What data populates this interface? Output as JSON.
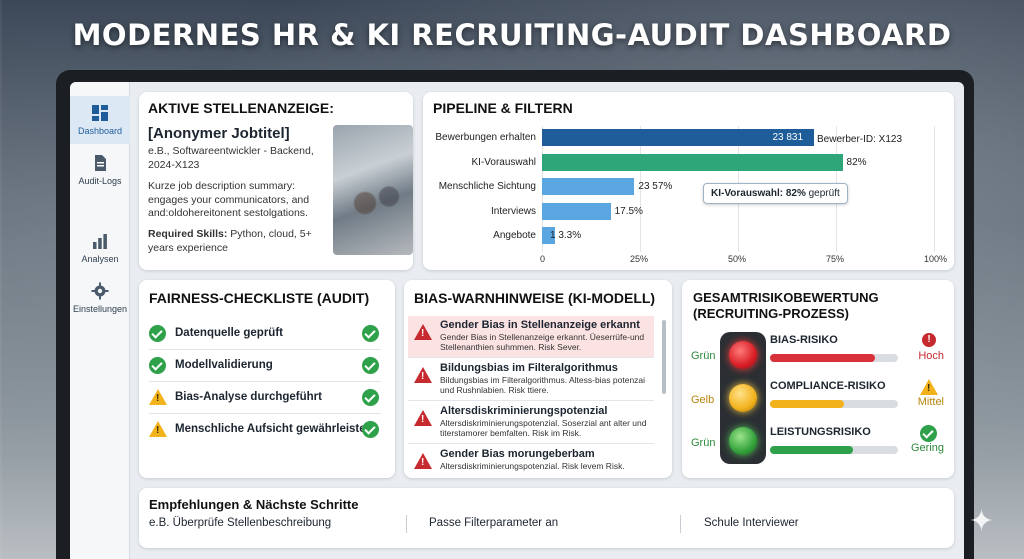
{
  "headline": "MODERNES HR & KI RECRUITING-AUDIT DASHBOARD",
  "sidebar": {
    "items": [
      {
        "label": "Dashboard",
        "icon": "dashboard-icon",
        "active": true
      },
      {
        "label": "Audit-Logs",
        "icon": "document-icon",
        "active": false
      },
      {
        "label": "Analysen",
        "icon": "bar-chart-icon",
        "active": false
      },
      {
        "label": "Einstellungen",
        "icon": "gear-icon",
        "active": false
      }
    ]
  },
  "job": {
    "heading": "AKTIVE STELLENANZEIGE:",
    "title": "[Anonymer Jobtitel]",
    "subtitle": "e.B., Softwareentwickler - Backend, 2024-X123",
    "summary": "Kurze job description summary: engages your communicators, and and:oldohereitonent sestolgations.",
    "skills_label": "Required Skills:",
    "skills_value": " Python, cloud, 5+ years experience"
  },
  "pipeline": {
    "heading": "PIPELINE & FILTERN",
    "tooltip_label": "KI-Vorauswahl: ",
    "tooltip_value": "82%",
    "tooltip_suffix": " geprüft",
    "id_label": "Bewerber-ID: X123"
  },
  "chart_data": {
    "type": "bar",
    "orientation": "horizontal",
    "categories": [
      "Bewerbungen erhalten",
      "KI-Vorauswahl",
      "Menschliche Sichtung",
      "Interviews",
      "Angebote"
    ],
    "values": [
      100,
      82,
      23.57,
      17.5,
      3.3
    ],
    "value_labels": [
      "23 831",
      "82%",
      "23 57%",
      "17.5%",
      "1 3.3%"
    ],
    "x_ticks": [
      "0",
      "25%",
      "50%",
      "75%",
      "100%"
    ],
    "xlim": [
      0,
      100
    ],
    "colors": [
      "#1f5d9a",
      "#2fa57a",
      "#5aa6e0",
      "#5aa6e0",
      "#5aa6e0"
    ]
  },
  "fairness": {
    "heading": "FAIRNESS-CHECKLISTE (AUDIT)",
    "items": [
      {
        "label": "Datenquelle geprüft",
        "left": "ok",
        "right": "ok"
      },
      {
        "label": "Modellvalidierung",
        "left": "ok",
        "right": "ok"
      },
      {
        "label": "Bias-Analyse durchgeführt",
        "left": "warn",
        "right": "ok"
      },
      {
        "label": "Menschliche Aufsicht gewährleistet",
        "left": "warn",
        "right": "ok"
      }
    ]
  },
  "bias": {
    "heading": "BIAS-WARNHINWEISE (KI-MODELL)",
    "items": [
      {
        "title": "Gender Bias in Stellenanzeige erkannt",
        "desc": "Gender Bias in Stellenanzeige erkannt. Üeserrüfe-und Stellenanthien suhmmen. Risk Sever."
      },
      {
        "title": "Bildungsbias im Filteralgorithmus",
        "desc": "Bildungsbias im Filteralgorithmus. Altess-bias potenzai und Rushnlabien. Risk ttiere."
      },
      {
        "title": "Altersdiskriminierungspotenzial",
        "desc": "Altersdiskriminierungspotenzial. Soserzial ant alter und titerstamorer bemfalten. Risk im Risk."
      },
      {
        "title": "Gender Bias morungeberbam",
        "desc": "Altersdiskriminierungspotenzial. Risk levem Risk."
      }
    ]
  },
  "risk": {
    "heading_line1": "GESAMTRISIKOBEWERTUNG",
    "heading_line2": "(RECRUITING-PROZESS)",
    "left_labels": [
      "Grün",
      "Gelb",
      "Grün"
    ],
    "items": [
      {
        "label": "BIAS-RISIKO",
        "level": "Hoch",
        "fill": 0.82,
        "color": "#d9313a"
      },
      {
        "label": "COMPLIANCE-RISIKO",
        "level": "Mittel",
        "fill": 0.58,
        "color": "#f2b21c"
      },
      {
        "label": "LEISTUNGSRISIKO",
        "level": "Gering",
        "fill": 0.65,
        "color": "#2fa14a"
      }
    ]
  },
  "recommendations": {
    "heading": "Empfehlungen & Nächste Schritte",
    "items": [
      "e.B. Überprüfe Stellenbeschreibung",
      "Passe Filterparameter an",
      "Schule Interviewer"
    ]
  }
}
